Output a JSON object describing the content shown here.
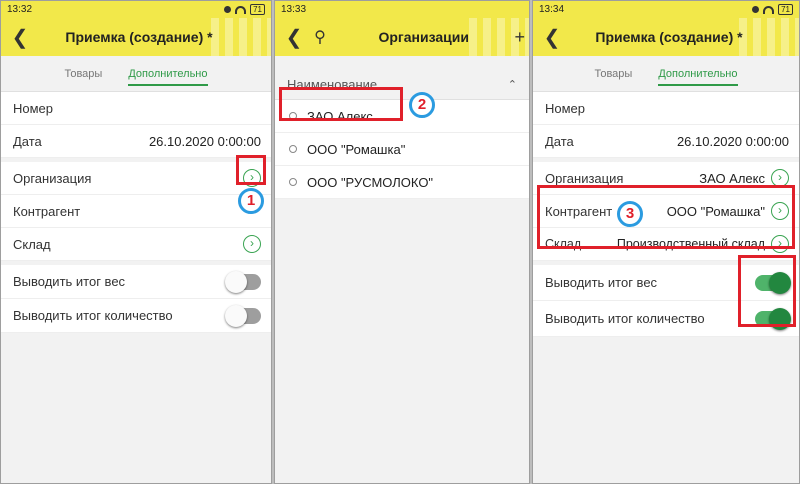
{
  "screens": [
    {
      "time": "13:32",
      "battery": "71",
      "title": "Приемка (создание) *",
      "tabs": [
        "Товары",
        "Дополнительно"
      ],
      "fields": {
        "number_label": "Номер",
        "date_label": "Дата",
        "date_value": "26.10.2020  0:00:00",
        "org_label": "Организация",
        "contr_label": "Контрагент",
        "warehouse_label": "Склад",
        "weight_label": "Выводить итог вес",
        "qty_label": "Выводить итог количество"
      },
      "badge": "1"
    },
    {
      "time": "13:33",
      "title": "Организации",
      "header": "Наименование",
      "items": [
        "ЗАО Алекс",
        "ООО \"Ромашка\"",
        "ООО \"РУСМОЛОКО\""
      ],
      "badge": "2"
    },
    {
      "time": "13:34",
      "battery": "71",
      "title": "Приемка (создание) *",
      "tabs": [
        "Товары",
        "Дополнительно"
      ],
      "fields": {
        "number_label": "Номер",
        "date_label": "Дата",
        "date_value": "26.10.2020  0:00:00",
        "org_label": "Организация",
        "org_value": "ЗАО Алекс",
        "contr_label": "Контрагент",
        "contr_value": "ООО \"Ромашка\"",
        "warehouse_label": "Склад",
        "warehouse_value": "Производственный склад",
        "weight_label": "Выводить итог вес",
        "qty_label": "Выводить итог количество"
      },
      "badge": "3"
    }
  ],
  "icons": {
    "back": "chevron-left-icon",
    "search": "search-icon",
    "add": "plus-icon",
    "open": "chevron-right-circle-icon"
  },
  "colors": {
    "appbar": "#f2e84a",
    "accent": "#2f9a48",
    "highlight": "#e0202a",
    "badge_ring": "#2b9be0"
  }
}
